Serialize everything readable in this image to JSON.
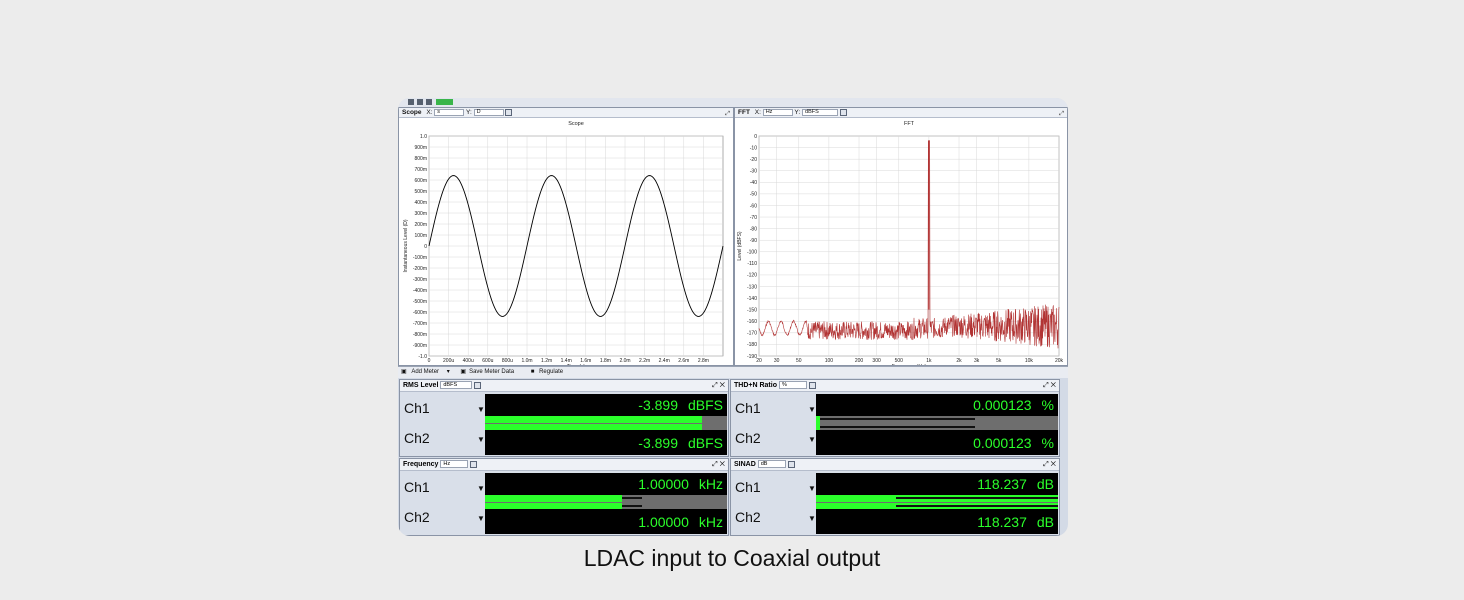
{
  "colors": {
    "green": "#2bff2b",
    "trace_scope": "#000000",
    "trace_fft": "#b23434"
  },
  "scope": {
    "title": "Scope",
    "x_label": "X:",
    "x_unit": "s",
    "y_label": "Y:",
    "y_unit": "D",
    "chart_title": "Scope",
    "xaxis_label": "Time (s)",
    "yaxis_label": "Instantaneous Level (D)"
  },
  "fft": {
    "title": "FFT",
    "x_label": "X:",
    "x_unit": "Hz",
    "y_label": "Y:",
    "y_unit": "dBFS",
    "chart_title": "FFT",
    "xaxis_label": "Frequency (Hz)",
    "yaxis_label": "Level (dBFS)"
  },
  "meterbar": {
    "add": "Add Meter",
    "save": "Save Meter Data",
    "regulate": "Regulate"
  },
  "meters": {
    "rms": {
      "title": "RMS Level",
      "unit_sel": "dBFS",
      "ch1": {
        "label": "Ch1",
        "value": "-3.899",
        "unit": "dBFS"
      },
      "ch2": {
        "label": "Ch2",
        "value": "-3.899",
        "unit": "dBFS"
      }
    },
    "thd": {
      "title": "THD+N Ratio",
      "unit_sel": "%",
      "ch1": {
        "label": "Ch1",
        "value": "0.000123",
        "unit": "%"
      },
      "ch2": {
        "label": "Ch2",
        "value": "0.000123",
        "unit": "%"
      }
    },
    "freq": {
      "title": "Frequency",
      "unit_sel": "Hz",
      "ch1": {
        "label": "Ch1",
        "value": "1.00000",
        "unit": "kHz"
      },
      "ch2": {
        "label": "Ch2",
        "value": "1.00000",
        "unit": "kHz"
      }
    },
    "sinad": {
      "title": "SINAD",
      "unit_sel": "dB",
      "ch1": {
        "label": "Ch1",
        "value": "118.237",
        "unit": "dB"
      },
      "ch2": {
        "label": "Ch2",
        "value": "118.237",
        "unit": "dB"
      }
    }
  },
  "caption": "LDAC input to Coaxial output",
  "chart_data": [
    {
      "type": "line",
      "title": "Scope",
      "xlabel": "Time (s)",
      "ylabel": "Instantaneous Level (D)",
      "xlim": [
        0,
        0.003
      ],
      "ylim": [
        -1.0,
        1.0
      ],
      "x_ticks": [
        "0",
        "200u",
        "400u",
        "600u",
        "800u",
        "1.0m",
        "1.2m",
        "1.4m",
        "1.6m",
        "1.8m",
        "2.0m",
        "2.2m",
        "2.4m",
        "2.6m",
        "2.8m"
      ],
      "y_ticks": [
        "1.0",
        "900m",
        "800m",
        "700m",
        "600m",
        "500m",
        "400m",
        "300m",
        "200m",
        "100m",
        "0",
        "-100m",
        "-200m",
        "-300m",
        "-400m",
        "-500m",
        "-600m",
        "-700m",
        "-800m",
        "-900m",
        "-1.0"
      ],
      "series": [
        {
          "amplitude": 0.64,
          "frequency_hz": 1000
        }
      ],
      "grid": true
    },
    {
      "type": "line",
      "title": "FFT",
      "xlabel": "Frequency (Hz)",
      "ylabel": "Level (dBFS)",
      "xscale": "log",
      "xlim": [
        20,
        20000
      ],
      "ylim": [
        -190,
        0
      ],
      "x_ticks": [
        "20",
        "30",
        "50",
        "100",
        "200",
        "300",
        "500",
        "1k",
        "2k",
        "3k",
        "5k",
        "10k",
        "20k"
      ],
      "y_ticks": [
        "0",
        "-10",
        "-20",
        "-30",
        "-40",
        "-50",
        "-60",
        "-70",
        "-80",
        "-90",
        "-100",
        "-110",
        "-120",
        "-130",
        "-140",
        "-150",
        "-160",
        "-170",
        "-180",
        "-190"
      ],
      "series": [
        {
          "peak_hz": 1000,
          "peak_db": -4,
          "floor_db": -168
        }
      ],
      "grid": true
    }
  ]
}
